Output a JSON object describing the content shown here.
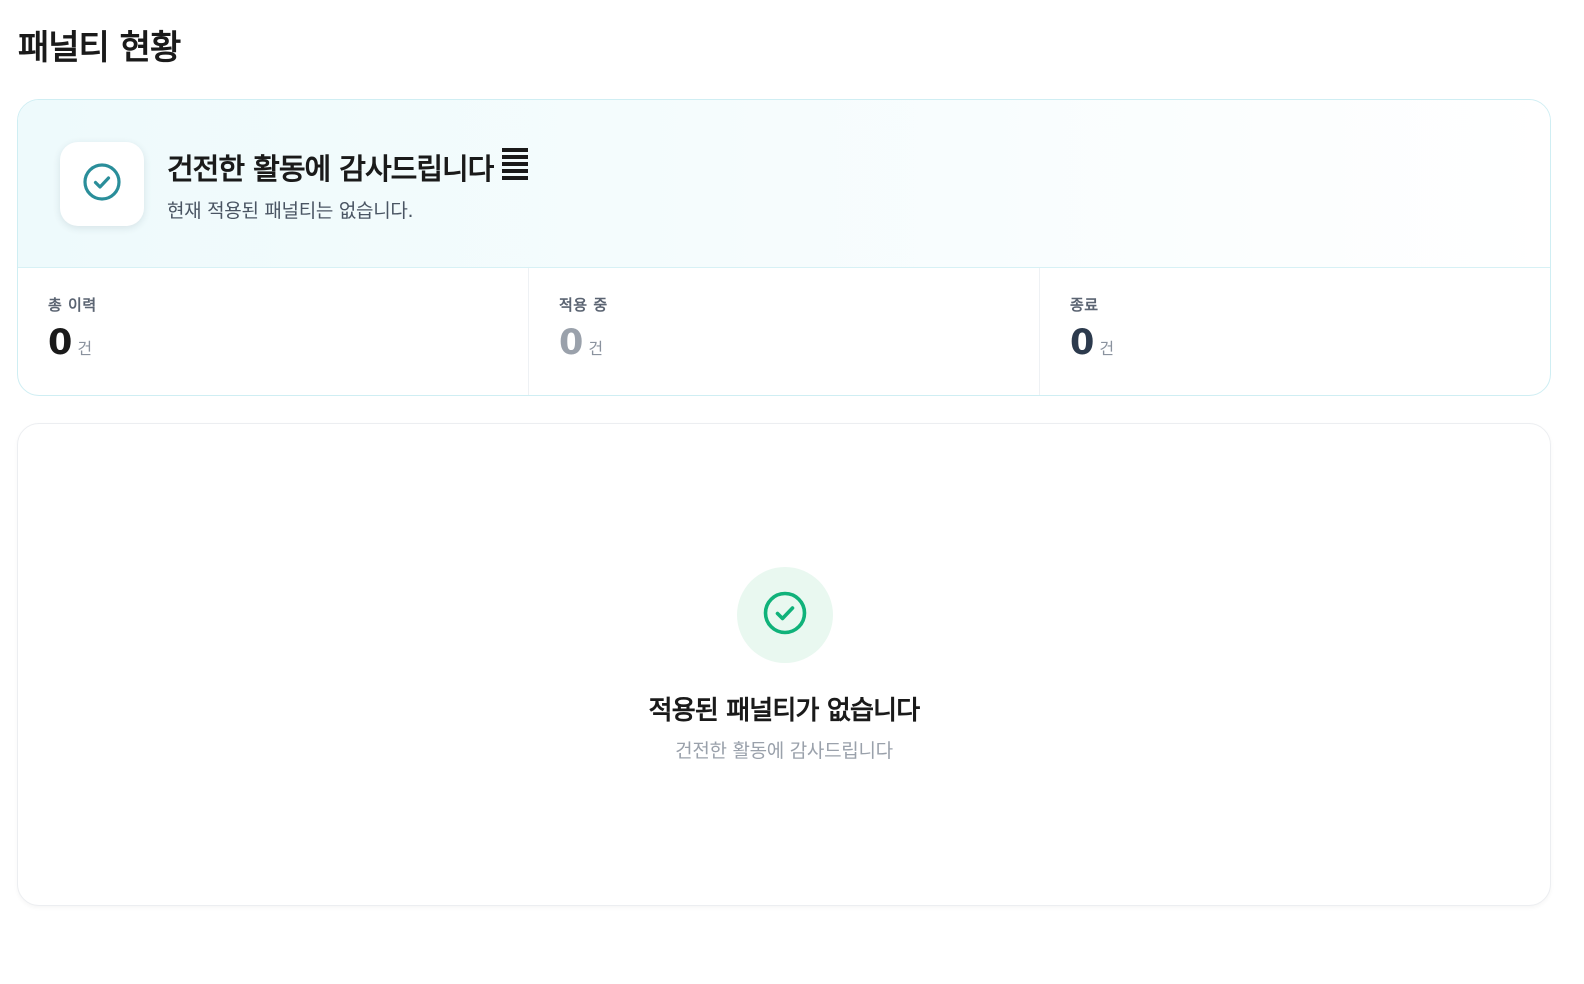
{
  "page": {
    "title": "패널티 현황"
  },
  "status_card": {
    "icon": "check-circle-icon",
    "icon_color": "#2a8e9a",
    "heading": "건전한 활동에 감사드립니다",
    "heading_glyph": "list-icon",
    "subtitle": "현재 적용된 패널티는 없습니다."
  },
  "stats": [
    {
      "label": "총 이력",
      "value": "0",
      "unit": "건",
      "color": "#1a1a1a"
    },
    {
      "label": "적용 중",
      "value": "0",
      "unit": "건",
      "color": "#9aa1ab"
    },
    {
      "label": "종료",
      "value": "0",
      "unit": "건",
      "color": "#2c3a4d"
    }
  ],
  "empty_state": {
    "icon": "check-circle-icon",
    "icon_color": "#10b27a",
    "icon_bg": "#e9f8f0",
    "title": "적용된 패널티가 없습니다",
    "subtitle": "건전한 활동에 감사드립니다"
  }
}
